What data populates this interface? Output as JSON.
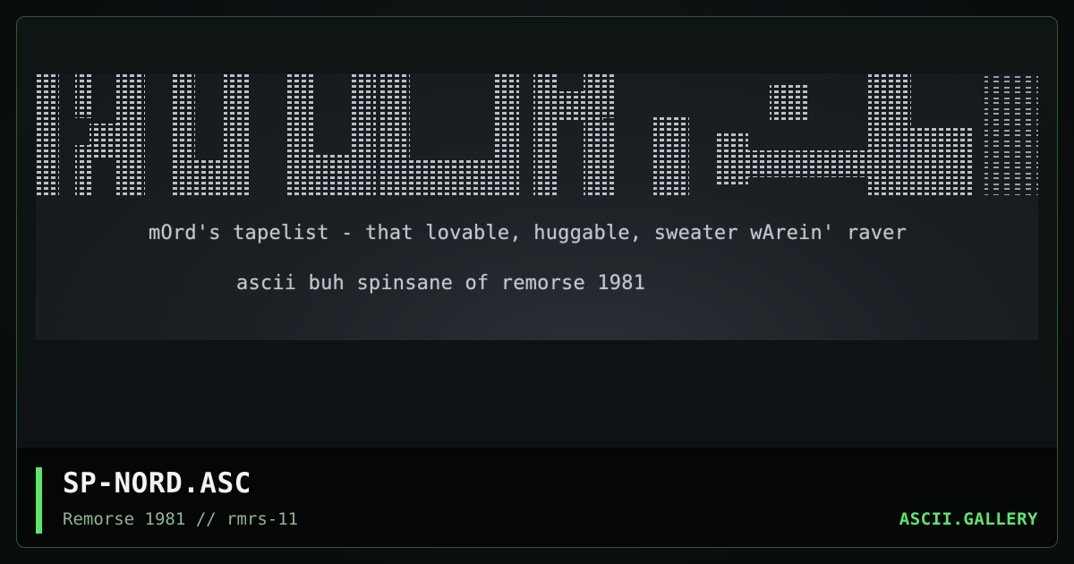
{
  "art": {
    "line1": "mOrd's tapelist - that lovable, huggable, sweater wArein' raver",
    "line2": "ascii buh spinsane of remorse 1981"
  },
  "footer": {
    "title": "SP-NORD.ASC",
    "subtitle": "Remorse 1981 // rmrs-11",
    "brand": "ASCII.GALLERY"
  },
  "colors": {
    "accent": "#59e86a",
    "border": "#2f5a34",
    "art_text": "#c2c6cc",
    "subtitle": "#8fb791"
  }
}
